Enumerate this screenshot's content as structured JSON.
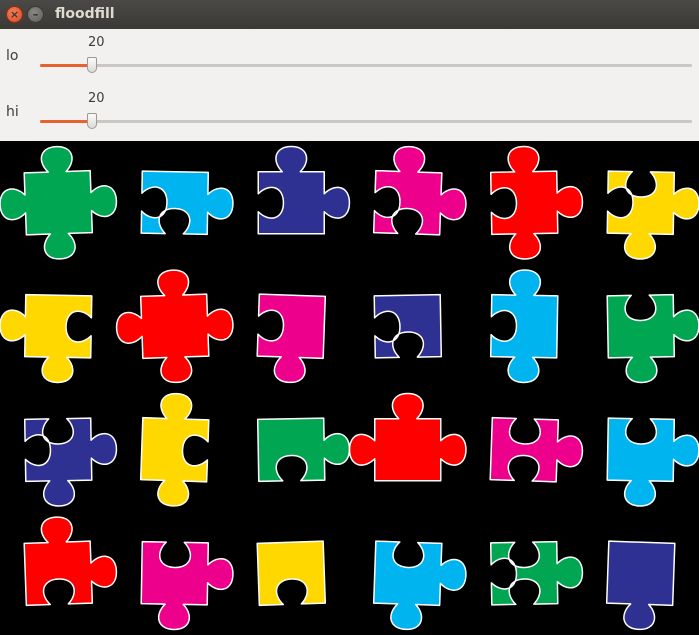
{
  "window": {
    "title": "floodfill"
  },
  "controls": {
    "lo": {
      "label": "lo",
      "value": "20",
      "fraction": 0.08
    },
    "hi": {
      "label": "hi",
      "value": "20",
      "fraction": 0.08
    }
  },
  "colors": {
    "accent": "#e8622f",
    "green": "#00a651",
    "cyan": "#00b4f0",
    "navy": "#2e3192",
    "magenta": "#ec008c",
    "red": "#ff0000",
    "yellow": "#ffd800"
  },
  "pieces": [
    {
      "color": "green"
    },
    {
      "color": "cyan"
    },
    {
      "color": "navy"
    },
    {
      "color": "magenta"
    },
    {
      "color": "red"
    },
    {
      "color": "yellow"
    },
    {
      "color": "yellow"
    },
    {
      "color": "red"
    },
    {
      "color": "magenta"
    },
    {
      "color": "navy"
    },
    {
      "color": "cyan"
    },
    {
      "color": "green"
    },
    {
      "color": "navy"
    },
    {
      "color": "yellow"
    },
    {
      "color": "green"
    },
    {
      "color": "red"
    },
    {
      "color": "magenta"
    },
    {
      "color": "cyan"
    },
    {
      "color": "red"
    },
    {
      "color": "magenta"
    },
    {
      "color": "yellow"
    },
    {
      "color": "cyan"
    },
    {
      "color": "green"
    },
    {
      "color": "navy"
    }
  ]
}
